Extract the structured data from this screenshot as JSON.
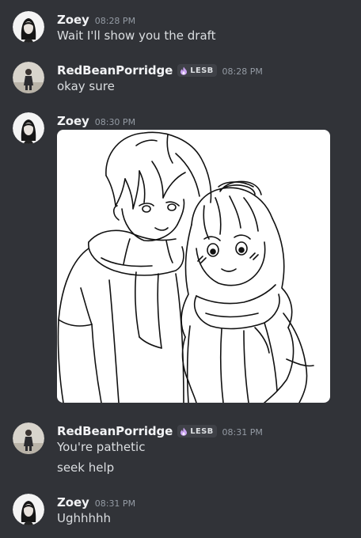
{
  "messages": [
    {
      "author": "Zoey",
      "time": "08:28 PM",
      "lines": [
        "Wait I'll show you the draft"
      ]
    },
    {
      "author": "RedBeanPorridge",
      "tag": "LESB",
      "time": "08:28 PM",
      "lines": [
        "okay sure"
      ]
    },
    {
      "author": "Zoey",
      "time": "08:30 PM",
      "attachment": "line-art-drawing"
    },
    {
      "author": "RedBeanPorridge",
      "tag": "LESB",
      "time": "08:31 PM",
      "lines": [
        "You're pathetic",
        "seek help"
      ]
    },
    {
      "author": "Zoey",
      "time": "08:31 PM",
      "lines": [
        "Ughhhhh"
      ]
    }
  ],
  "icons": {
    "tag_icon": "flame-icon"
  },
  "colors": {
    "background": "#313338",
    "username": "#f2f3f5",
    "text": "#dbdee1",
    "timestamp": "#949ba4",
    "tag_background": "#3f4147",
    "tag_icon": "#c9a2f0"
  }
}
